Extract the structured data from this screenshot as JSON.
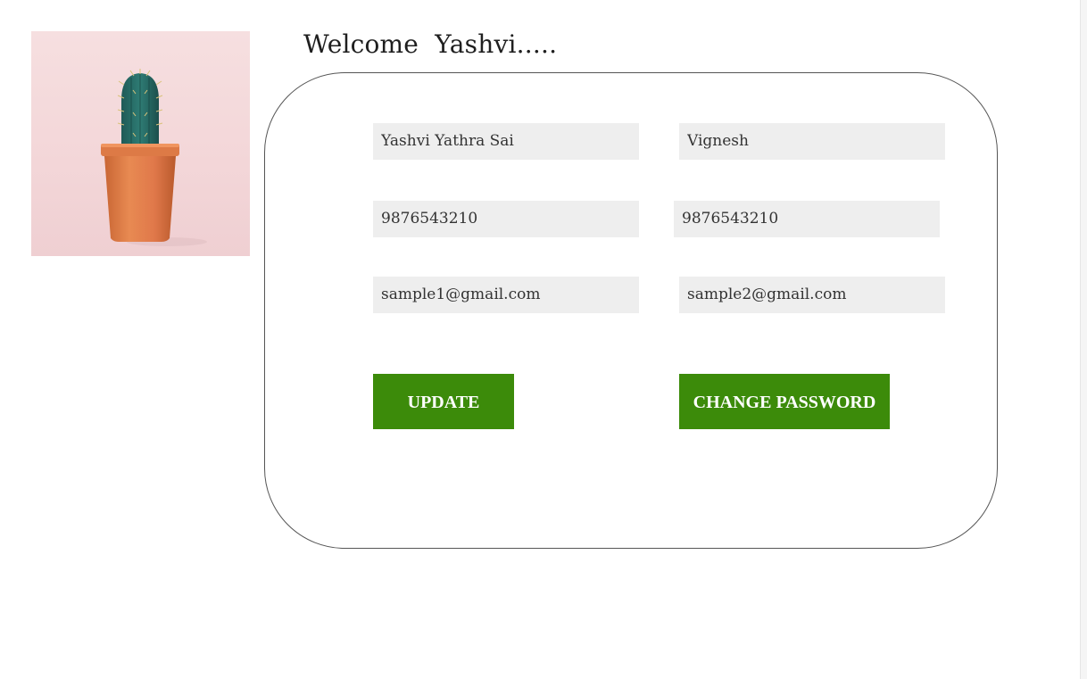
{
  "profile": {
    "photo_icon": "cactus-photo"
  },
  "welcome": {
    "text": "Welcome  Yashvi....."
  },
  "form": {
    "first_name": "Yashvi Yathra Sai",
    "second_name": "Vignesh",
    "phone_1": "9876543210",
    "phone_2": "9876543210",
    "email_1": "sample1@gmail.com",
    "email_2": "sample2@gmail.com"
  },
  "buttons": {
    "update_label": "UPDATE",
    "change_password_label": "CHANGE PASSWORD"
  },
  "colors": {
    "button_green": "#3c8b0a",
    "field_background": "#eeeeee",
    "card_border": "#555555"
  }
}
